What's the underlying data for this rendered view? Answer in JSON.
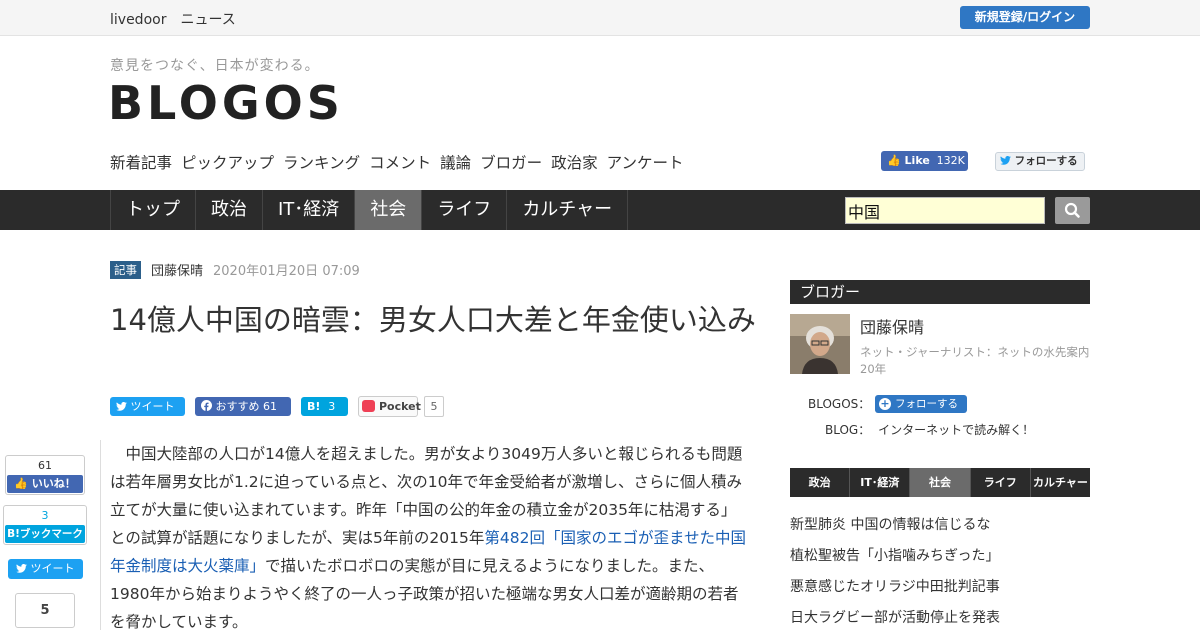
{
  "topbar": {
    "brand": "livedoor　ニュース",
    "login": "新規登録/ログイン"
  },
  "header": {
    "tagline": "意見をつなぐ、日本が変わる。",
    "logo": "BLOGOS",
    "subnav": [
      "新着記事",
      "ピックアップ",
      "ランキング",
      "コメント",
      "議論",
      "ブロガー",
      "政治家",
      "アンケート"
    ],
    "fb_like_label": "Like",
    "fb_like_count": "132K",
    "twitter_follow": "フォローする"
  },
  "mainnav": {
    "items": [
      "トップ",
      "政治",
      "IT･経済",
      "社会",
      "ライフ",
      "カルチャー"
    ],
    "active": "社会",
    "search_value": "中国"
  },
  "article": {
    "badge": "記事",
    "author": "団藤保晴",
    "date": "2020年01月20日 07:09",
    "title": "14億人中国の暗雲：男女人口大差と年金使い込み",
    "share": {
      "tweet": "ツイート",
      "fb_label": "おすすめ",
      "fb_count": "61",
      "hb_count": "3",
      "pocket_label": "Pocket",
      "pocket_count": "5"
    },
    "body_1": "　中国大陸部の人口が14億人を超えました。男が女より3049万人多いと報じられるも問題は若年層男女比が1.2に迫っている点と、次の10年で年金受給者が激増し、さらに個人積み立てが大量に使い込まれています。昨年「中国の公的年金の積立金が2035年に枯渇する」との試算が話題になりましたが、実は5年前の2015年",
    "body_link": "第482回「国家のエゴが歪ませた中国年金制度は大火薬庫」",
    "body_2": "で描いたボロボロの実態が目に見えるようになりました。また、1980年から始まりようやく終了の一人っ子政策が招いた極端な男女人口差が適齢期の若者を脅かしています。"
  },
  "floating_social": {
    "fb_count": "61",
    "fb_label": "いいね！",
    "hb_count": "3",
    "hb_label": "B!ブックマーク",
    "tweet": "ツイート",
    "pocket_count": "5"
  },
  "sidebar": {
    "blogger_heading": "ブロガー",
    "blogger_name": "団藤保晴",
    "blogger_desc": "ネット・ジャーナリスト：ネットの水先案内20年",
    "blogos_label": "BLOGOS：",
    "follow": "フォローする",
    "blog_label": "BLOG：",
    "blog_name": "インターネットで読み解く！",
    "category_tabs": [
      "政治",
      "IT･経済",
      "社会",
      "ライフ",
      "カルチャー"
    ],
    "category_active": "社会",
    "news": [
      "新型肺炎 中国の情報は信じるな",
      "植松聖被告「小指噛みちぎった」",
      "悪意感じたオリラジ中田批判記事",
      "日大ラグビー部が活動停止を発表"
    ]
  },
  "colors": {
    "nav_bg": "#2b2b2b",
    "nav_active": "#6b6b6b",
    "link": "#1a5fb4",
    "accent_blue": "#2f77c4"
  }
}
